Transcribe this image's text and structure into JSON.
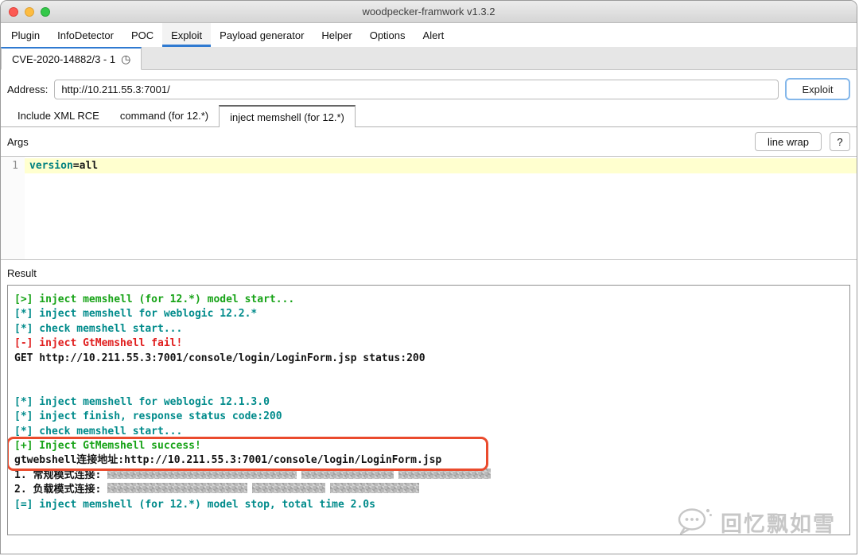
{
  "window": {
    "title": "woodpecker-framwork v1.3.2"
  },
  "menu": {
    "items": [
      {
        "label": "Plugin"
      },
      {
        "label": "InfoDetector"
      },
      {
        "label": "POC"
      },
      {
        "label": "Exploit",
        "active": true
      },
      {
        "label": "Payload generator"
      },
      {
        "label": "Helper"
      },
      {
        "label": "Options"
      },
      {
        "label": "Alert"
      }
    ]
  },
  "tabs": {
    "items": [
      {
        "label": "CVE-2020-14882/3 - 1",
        "icon": "◷"
      }
    ]
  },
  "address": {
    "label": "Address:",
    "value": "http://10.211.55.3:7001/",
    "button": "Exploit"
  },
  "subtabs": {
    "items": [
      {
        "label": "Include XML RCE"
      },
      {
        "label": "command (for 12.*)"
      },
      {
        "label": "inject memshell (for 12.*)",
        "active": true
      }
    ]
  },
  "args": {
    "label": "Args",
    "line_wrap_button": "line wrap",
    "help_button": "?",
    "line_number": "1",
    "code": {
      "keyword": "version",
      "rest": "=all"
    }
  },
  "result": {
    "label": "Result",
    "lines": [
      {
        "text": "[>] inject memshell (for 12.*) model start...",
        "color": "green"
      },
      {
        "text": "[*] inject memshell for weblogic 12.2.*",
        "color": "teal"
      },
      {
        "text": "[*] check memshell start...",
        "color": "teal"
      },
      {
        "text": "[-] inject GtMemshell fail!",
        "color": "red"
      },
      {
        "text": "GET http://10.211.55.3:7001/console/login/LoginForm.jsp status:200",
        "color": "black"
      },
      {
        "text": "",
        "color": "black"
      },
      {
        "text": "",
        "color": "black"
      },
      {
        "text": "[*] inject memshell for weblogic 12.1.3.0",
        "color": "teal"
      },
      {
        "text": "[*] inject finish, response status code:200",
        "color": "teal"
      },
      {
        "text": "[*] check memshell start...",
        "color": "teal"
      },
      {
        "text": "[+] Inject GtMemshell success!",
        "color": "green",
        "highlighted": true
      },
      {
        "text": "gtwebshell连接地址:http://10.211.55.3:7001/console/login/LoginForm.jsp",
        "color": "black",
        "highlighted": true
      },
      {
        "text": "1. 常规模式连接: ",
        "color": "black",
        "redactions": [
          238,
          116,
          116
        ]
      },
      {
        "text": "2. 负载模式连接: ",
        "color": "black",
        "redactions": [
          176,
          92,
          112
        ]
      },
      {
        "text": "[=] inject memshell (for 12.*) model stop, total time 2.0s",
        "color": "teal"
      }
    ]
  },
  "watermark": {
    "text": "回忆飘如雪"
  },
  "colors": {
    "accent_blue": "#2f7ad1",
    "terminal_green": "#17a317",
    "terminal_teal": "#008b8b",
    "terminal_red": "#e01e1e",
    "annotation_red": "#ea4b2d",
    "current_line": "#ffffcf"
  }
}
